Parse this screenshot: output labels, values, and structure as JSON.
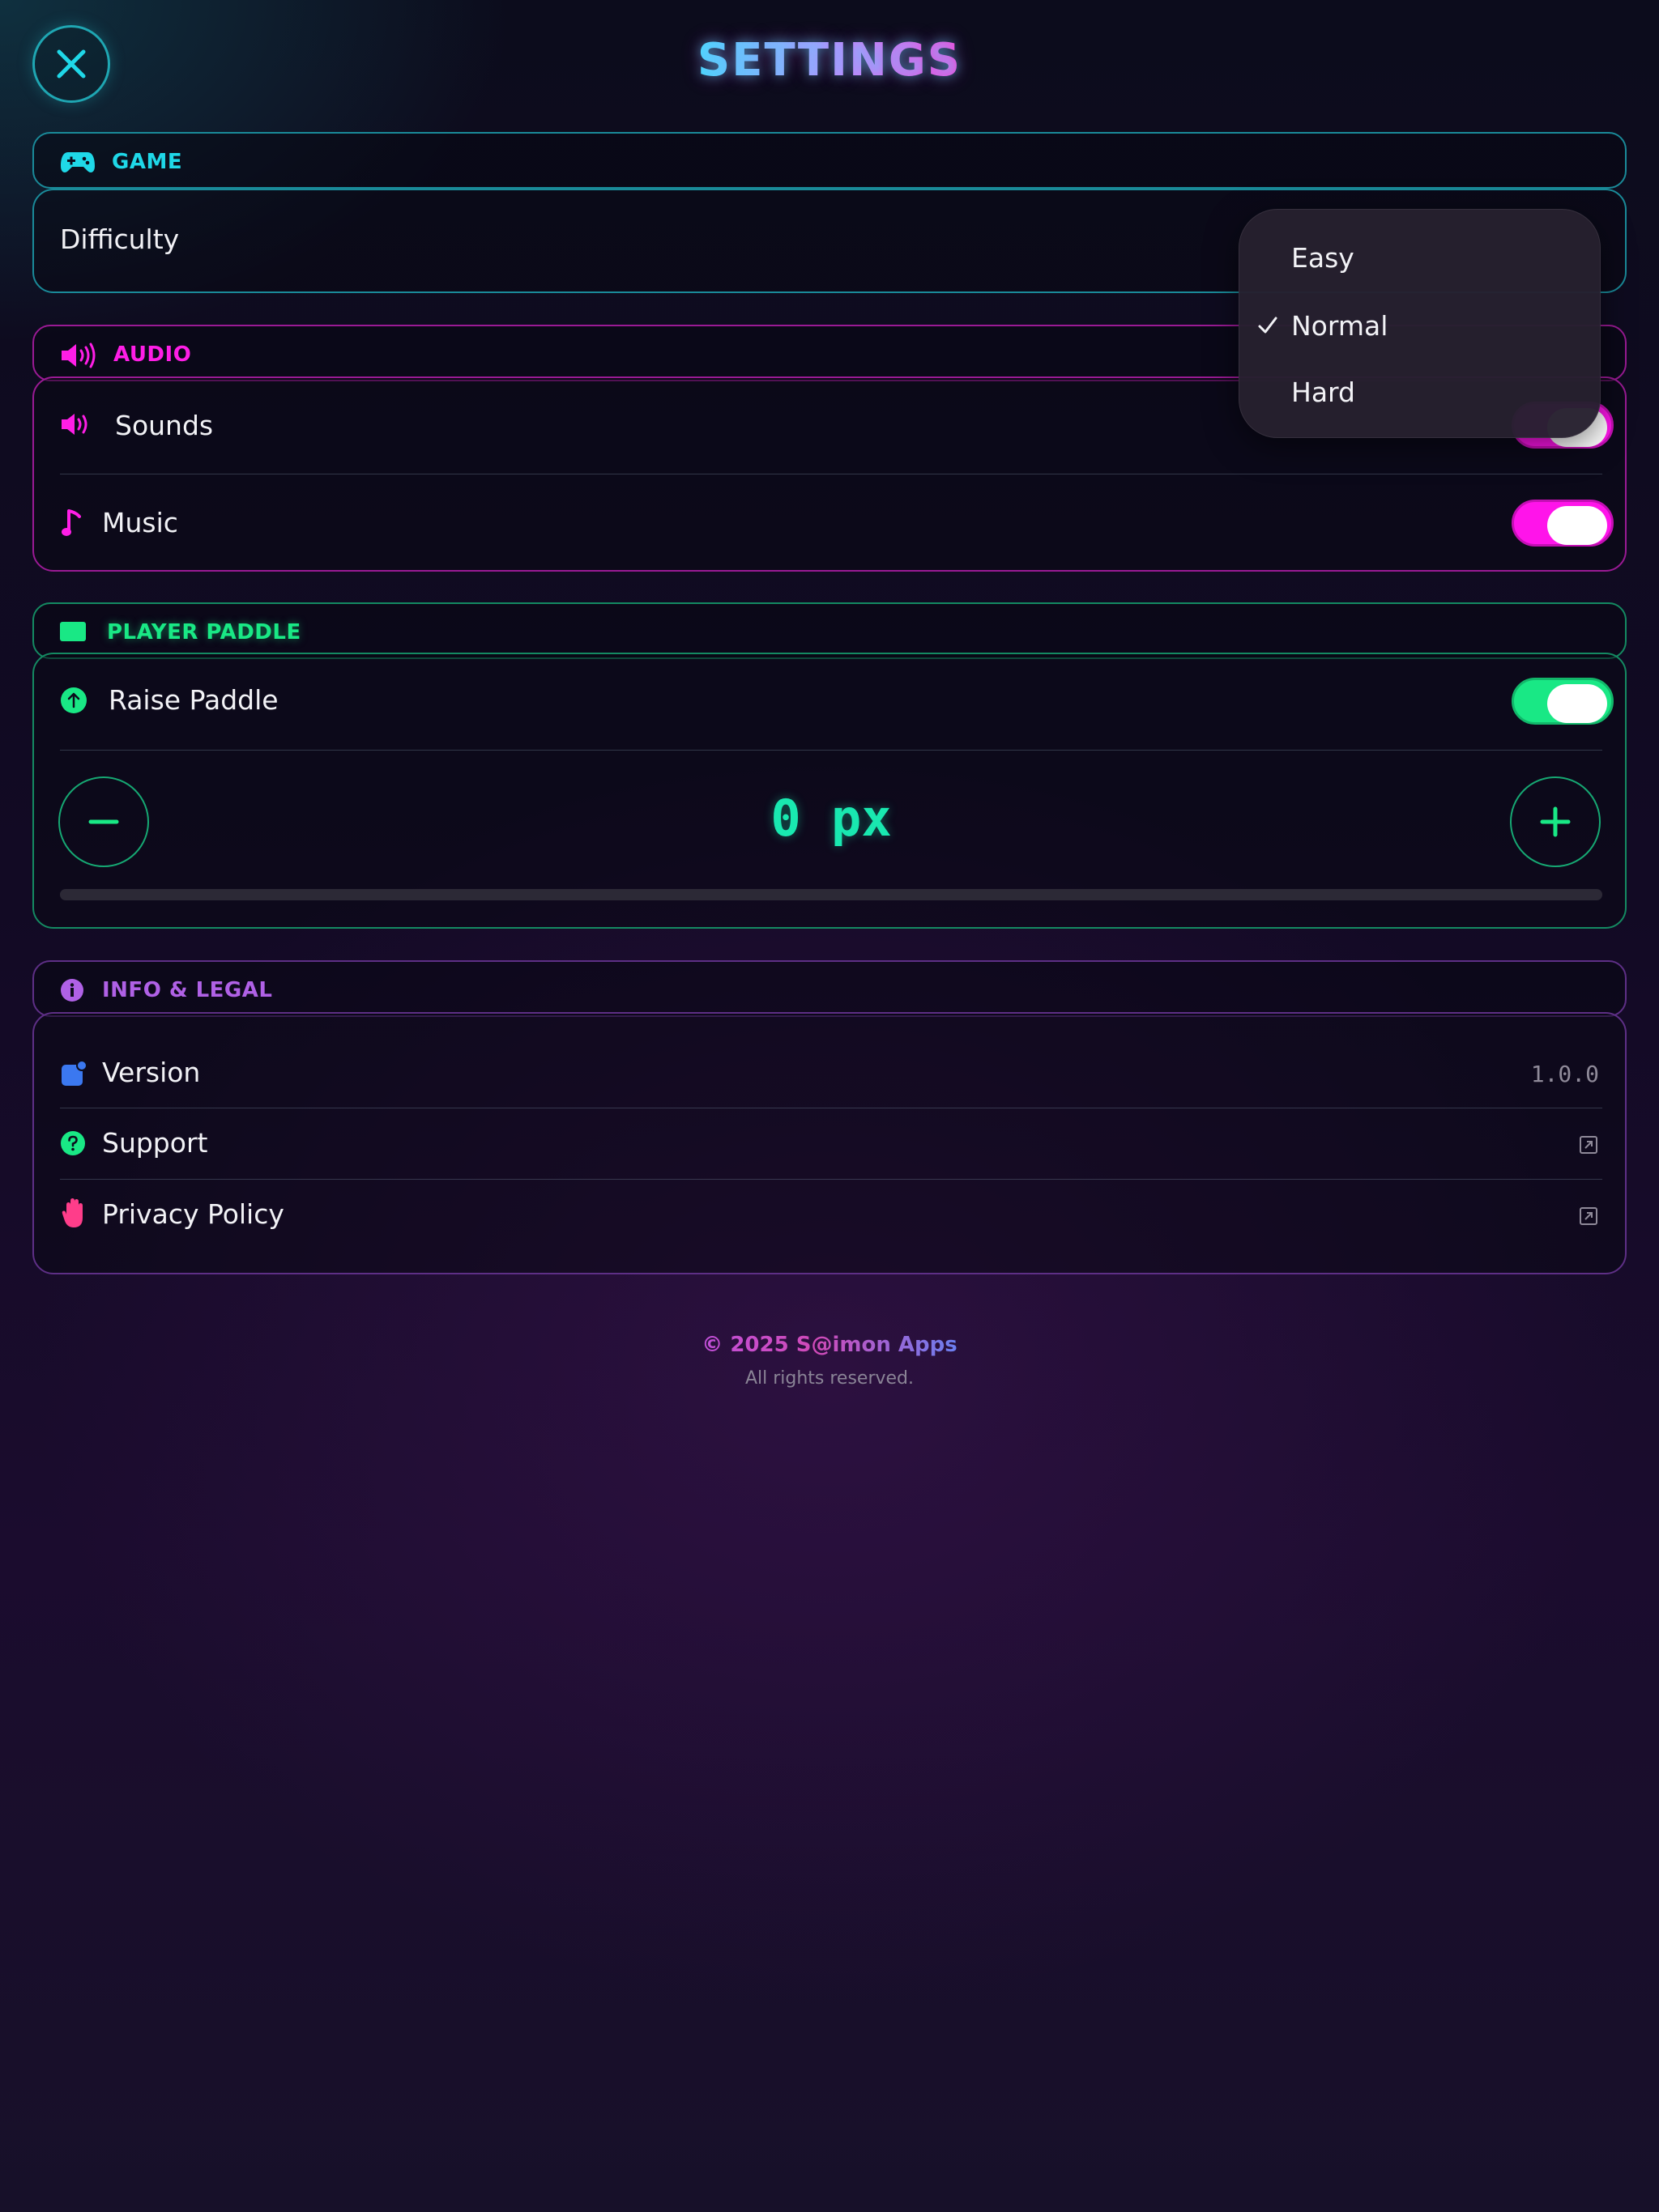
{
  "header": {
    "title": "SETTINGS"
  },
  "sections": {
    "game": {
      "label": "GAME",
      "color": "#1fd8e8",
      "difficulty_label": "Difficulty"
    },
    "audio": {
      "label": "AUDIO",
      "color": "#ff1ee6",
      "sounds_label": "Sounds",
      "sounds_on": true,
      "music_label": "Music",
      "music_on": true
    },
    "paddle": {
      "label": "PLAYER PADDLE",
      "color": "#19e885",
      "raise_label": "Raise Paddle",
      "raise_on": true,
      "offset_value": "0 px",
      "offset_fraction": 0
    },
    "info": {
      "label": "INFO & LEGAL",
      "color": "#b061e6",
      "version_label": "Version",
      "version_value": "1.0.0",
      "support_label": "Support",
      "privacy_label": "Privacy Policy"
    }
  },
  "dropdown": {
    "options": [
      "Easy",
      "Normal",
      "Hard"
    ],
    "selected": "Normal"
  },
  "footer": {
    "copyright": "© 2025 S@imon Apps",
    "rights": "All rights reserved."
  },
  "icons": {
    "close": "close-icon",
    "game": "gamepad-icon",
    "audio": "speaker-icon",
    "music": "music-note-icon",
    "paddle": "paddle-icon",
    "raise": "arrow-up-circle-icon",
    "info": "info-icon",
    "version": "app-badge-icon",
    "support": "question-icon",
    "privacy": "hand-icon",
    "external": "external-link-icon"
  }
}
